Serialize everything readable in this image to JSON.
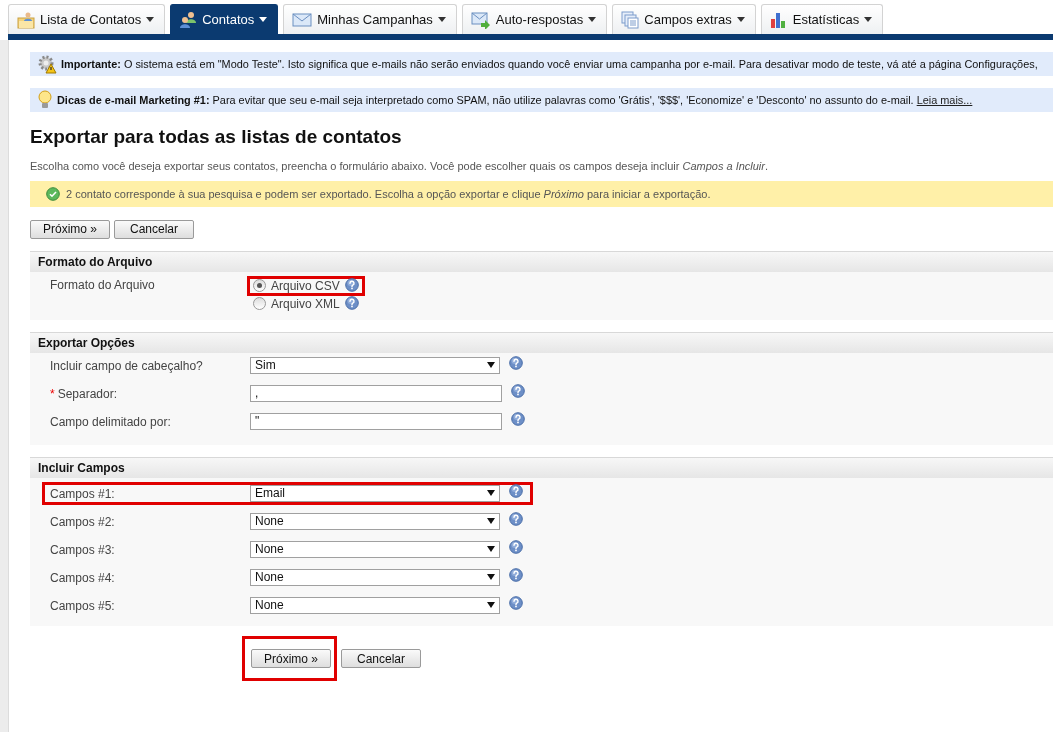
{
  "tabs": [
    {
      "label": "Lista de Contatos",
      "selected": false
    },
    {
      "label": "Contatos",
      "selected": true
    },
    {
      "label": "Minhas Campanhas",
      "selected": false
    },
    {
      "label": "Auto-respostas",
      "selected": false
    },
    {
      "label": "Campos extras",
      "selected": false
    },
    {
      "label": "Estatísticas",
      "selected": false
    }
  ],
  "notices": [
    {
      "kind": "warning",
      "title": "Importante:",
      "text": "O sistema está em \"Modo Teste\". Isto significa que e-mails não serão enviados quando você enviar uma campanha por e-mail. Para desativar modo de teste, vá até a página Configurações,"
    },
    {
      "kind": "tip",
      "title": "Dicas de e-mail Marketing #1:",
      "text": "Para evitar que seu e-mail seja interpretado como SPAM, não utilize palavras como 'Grátis', '$$$', 'Economize' e 'Desconto' no assunto do e-mail.",
      "link": "Leia mais..."
    }
  ],
  "page": {
    "title": "Exportar para todas as listas de contatos",
    "description": "Escolha como você deseja exportar seus contatos, preencha o formulário abaixo. Você pode escolher quais os campos deseja incluir *Campos a Incluir*.",
    "success": "2 contato corresponde à sua pesquisa e podem ser exportado. Escolha a opção exportar e clique *Próximo* para iniciar a exportação."
  },
  "top_buttons": [
    {
      "label": "Próximo »"
    },
    {
      "label": "Cancelar"
    }
  ],
  "sections": [
    {
      "title": "Formato do Arquivo",
      "rows": [
        {
          "kind": "radio",
          "label": "Formato do Arquivo",
          "options": [
            {
              "label": "Arquivo CSV",
              "selected": true,
              "highlighted": true
            },
            {
              "label": "Arquivo XML",
              "selected": false,
              "highlighted": false
            }
          ]
        }
      ]
    },
    {
      "title": "Exportar Opções",
      "rows": [
        {
          "kind": "select",
          "label": "Incluir campo de cabeçalho?",
          "value": "Sim"
        },
        {
          "kind": "text",
          "label": "Separador:",
          "marker": "*",
          "value": ","
        },
        {
          "kind": "text",
          "label": "Campo delimitado por:",
          "value": "\""
        }
      ]
    },
    {
      "title": "Incluir Campos",
      "rows": [
        {
          "kind": "select",
          "label": "Campos #1:",
          "value": "Email",
          "highlighted": true
        },
        {
          "kind": "select",
          "label": "Campos #2:",
          "value": "None",
          "highlighted": false
        },
        {
          "kind": "select",
          "label": "Campos #3:",
          "value": "None",
          "highlighted": false
        },
        {
          "kind": "select",
          "label": "Campos #4:",
          "value": "None",
          "highlighted": false
        },
        {
          "kind": "select",
          "label": "Campos #5:",
          "value": "None",
          "highlighted": false
        }
      ]
    }
  ],
  "bottom_buttons": [
    {
      "label": "Próximo »",
      "highlighted": true
    },
    {
      "label": "Cancelar",
      "highlighted": false
    }
  ]
}
